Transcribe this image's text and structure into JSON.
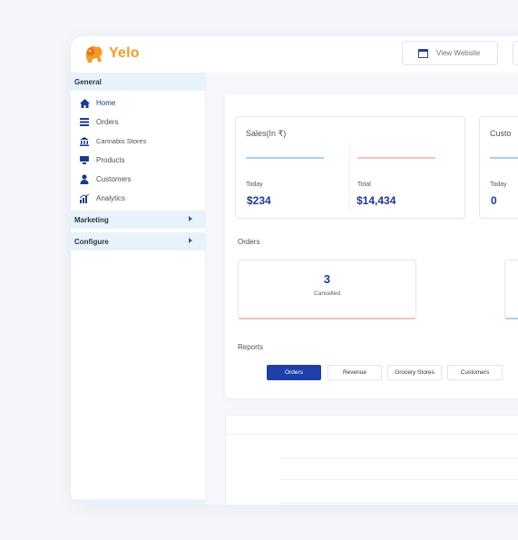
{
  "brand": {
    "name": "Yelo"
  },
  "header": {
    "view_website_label": "View Website"
  },
  "sidebar": {
    "general_label": "General",
    "items": [
      {
        "label": "Home",
        "icon": "home-icon"
      },
      {
        "label": "Orders",
        "icon": "orders-icon"
      },
      {
        "label": "Cannabis Stores",
        "icon": "store-icon"
      },
      {
        "label": "Products",
        "icon": "products-icon"
      },
      {
        "label": "Customers",
        "icon": "customer-icon"
      },
      {
        "label": "Analytics",
        "icon": "analytics-icon"
      }
    ],
    "marketing_label": "Marketing",
    "configure_label": "Configure"
  },
  "sales": {
    "title": "Sales(In ₹)",
    "today_label": "Today",
    "today_value": "$234",
    "total_label": "Total",
    "total_value": "$14,434"
  },
  "customers_card": {
    "title": "Custo",
    "today_label": "Today",
    "today_value": "0"
  },
  "orders": {
    "section_title": "Orders",
    "cancelled_count": "3",
    "cancelled_label": "Cancelled"
  },
  "reports": {
    "section_title": "Reports",
    "tabs": [
      "Orders",
      "Revenue",
      "Grocery Stores",
      "Customers"
    ]
  },
  "colors": {
    "accent": "#1e3a8a",
    "brand_orange": "#f39a2b",
    "today_line": "#a7d2f2",
    "total_line": "#f4c3ba"
  }
}
